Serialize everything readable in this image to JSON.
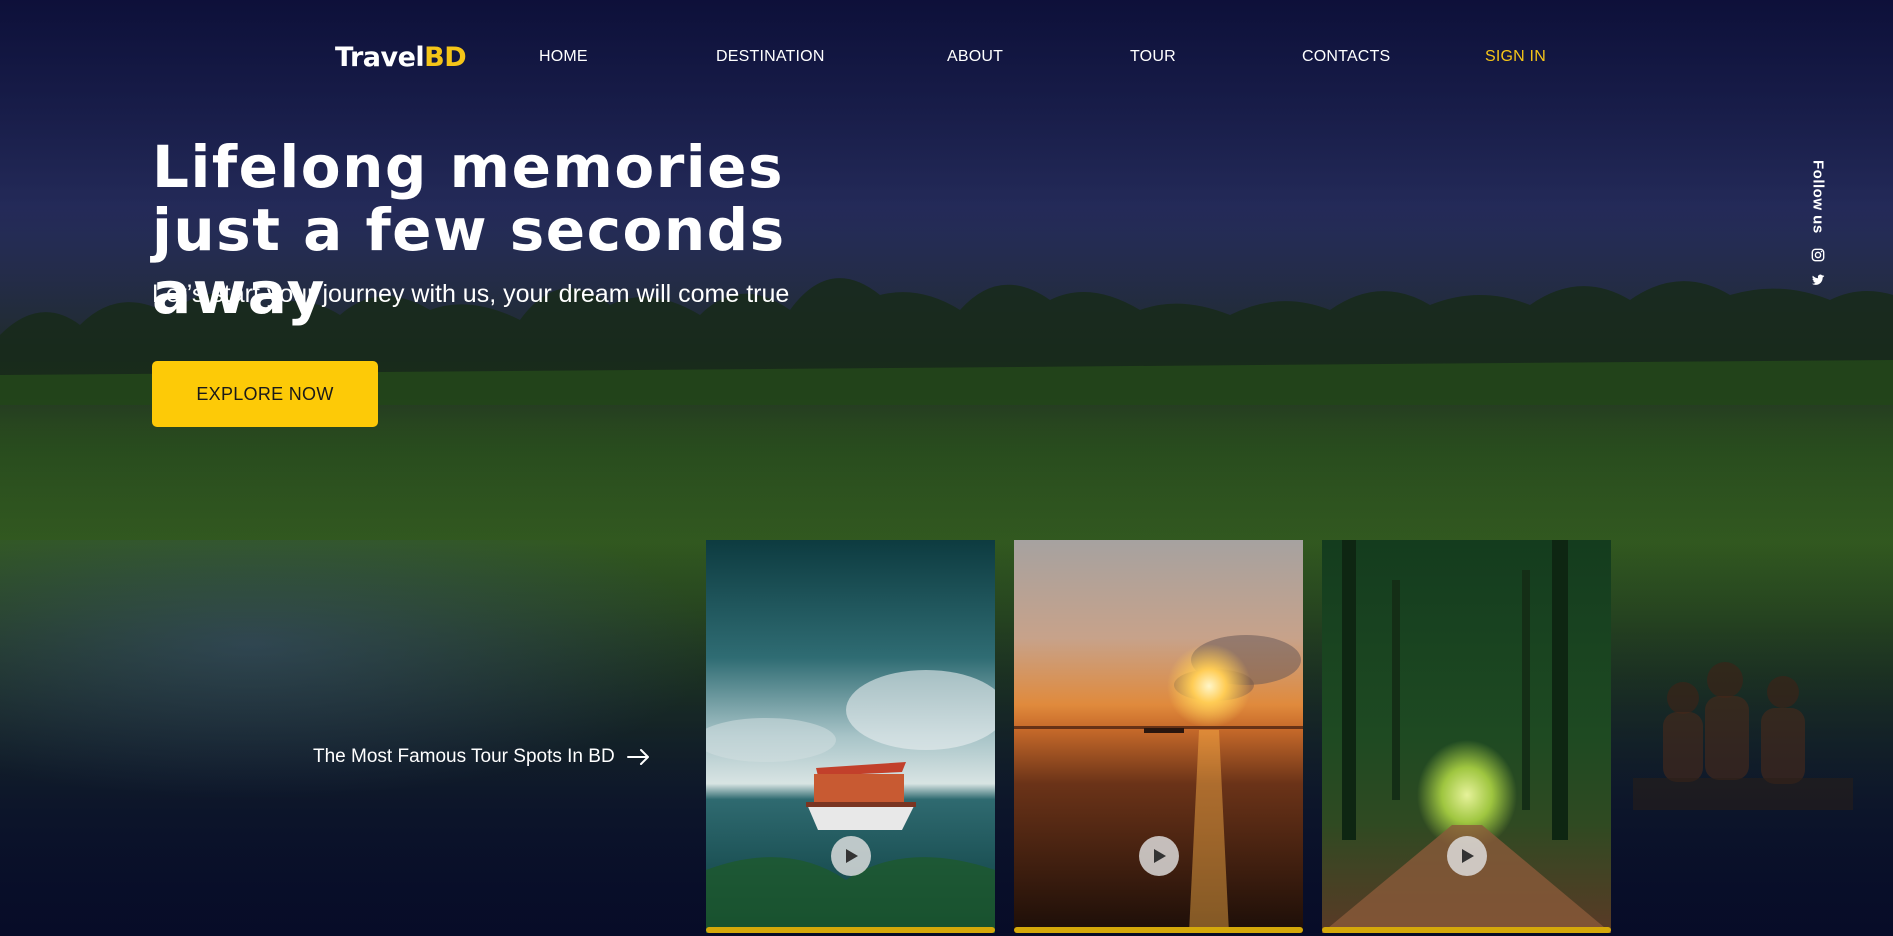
{
  "brand": {
    "part1": "Travel",
    "part2": "BD"
  },
  "nav": {
    "home": "HOME",
    "destination": "DESTINATION",
    "about": "ABOUT",
    "tour": "TOUR",
    "contacts": "CONTACTS",
    "signin": "SIGN IN"
  },
  "hero": {
    "title": "Lifelong memories just a few seconds away",
    "subtitle": "Let’s start your journey with us, your dream will come true",
    "cta": "EXPLORE NOW"
  },
  "follow": {
    "label": "Follow us",
    "icons": [
      "instagram-icon",
      "twitter-icon"
    ]
  },
  "famous": {
    "label": "The Most Famous Tour Spots In BD",
    "icon": "arrow-right-icon"
  },
  "cards": [
    {
      "scene": "boat-on-river",
      "icon": "play-icon"
    },
    {
      "scene": "sunset-over-water",
      "icon": "play-icon"
    },
    {
      "scene": "forest-path",
      "icon": "play-icon"
    }
  ],
  "colors": {
    "accent": "#fdca07",
    "nav_dark": "#0c1233",
    "card_bar": "#d4a80a"
  }
}
